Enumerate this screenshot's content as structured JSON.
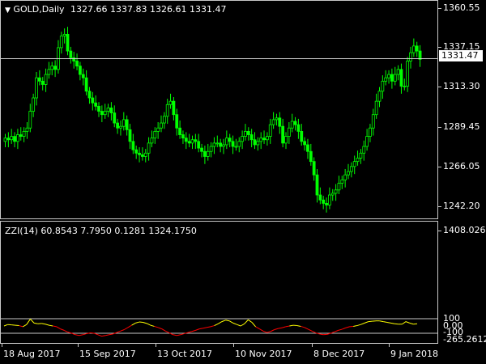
{
  "symbol_header": {
    "icon": "triangle-down-icon",
    "symbol": "GOLD,Daily",
    "ohlc": "1327.66 1337.83 1326.61 1331.47"
  },
  "price_scale": [
    "1360.55",
    "1337.15",
    "1313.30",
    "1289.45",
    "1266.05",
    "1242.20"
  ],
  "current_price": "1331.47",
  "indicator_header": "ZZI(14) 60.8543 7.7950 0.1281 1324.1750",
  "indicator_scale": {
    "max": "1408.0261",
    "upper": "100",
    "zero": "0.00",
    "lower": "-100",
    "min": "-265.2612"
  },
  "date_axis": [
    "18 Aug 2017",
    "15 Sep 2017",
    "13 Oct 2017",
    "10 Nov 2017",
    "8 Dec 2017",
    "9 Jan 2018"
  ],
  "colors": {
    "background": "#000000",
    "candle": "#00ff00",
    "indicator_high": "#ffff00",
    "indicator_low": "#ff0000",
    "grid": "#c8c8c8"
  },
  "chart_data": [
    {
      "type": "candlestick",
      "title": "GOLD,Daily",
      "ylim": [
        1236,
        1366
      ],
      "series": [
        {
          "values": [
            1284,
            1283,
            1285,
            1282,
            1286,
            1285,
            1288,
            1290,
            1300,
            1308,
            1320,
            1318,
            1316,
            1322,
            1325,
            1327,
            1325,
            1338,
            1345,
            1346,
            1336,
            1332,
            1330,
            1327,
            1322,
            1320,
            1312,
            1308,
            1305,
            1303,
            1300,
            1298,
            1300,
            1302,
            1299,
            1293,
            1290,
            1291,
            1295,
            1289,
            1282,
            1277,
            1275,
            1274,
            1273,
            1275,
            1281,
            1284,
            1288,
            1290,
            1293,
            1297,
            1304,
            1306,
            1298,
            1290,
            1286,
            1284,
            1282,
            1281,
            1283,
            1282,
            1278,
            1276,
            1273,
            1276,
            1279,
            1281,
            1281,
            1279,
            1280,
            1284,
            1282,
            1279,
            1279,
            1282,
            1285,
            1288,
            1286,
            1283,
            1280,
            1282,
            1284,
            1283,
            1285,
            1292,
            1295,
            1296,
            1291,
            1281,
            1285,
            1290,
            1294,
            1292,
            1288,
            1282,
            1280,
            1276,
            1270,
            1262,
            1250,
            1247,
            1245,
            1244,
            1250,
            1251,
            1253,
            1257,
            1259,
            1262,
            1264,
            1267,
            1270,
            1272,
            1275,
            1279,
            1285,
            1290,
            1298,
            1306,
            1312,
            1318,
            1320,
            1322,
            1318,
            1322,
            1325,
            1315,
            1315,
            1330,
            1335,
            1339,
            1336,
            1331
          ]
        }
      ]
    },
    {
      "type": "line",
      "title": "ZZI(14)",
      "ylim": [
        -265.2612,
        1408.0261
      ],
      "series": [
        {
          "values": [
            0,
            20,
            15,
            10,
            5,
            -10,
            20,
            95,
            40,
            30,
            35,
            25,
            10,
            0,
            -10,
            -40,
            -60,
            -85,
            -100,
            -120,
            -130,
            -120,
            -105,
            -95,
            -100,
            -120,
            -140,
            -130,
            -120,
            -110,
            -90,
            -70,
            -50,
            -20,
            10,
            40,
            55,
            50,
            35,
            10,
            -5,
            -20,
            -40,
            -70,
            -95,
            -120,
            -130,
            -120,
            -105,
            -90,
            -75,
            -60,
            -40,
            -30,
            -20,
            -10,
            5,
            30,
            60,
            80,
            70,
            40,
            20,
            0,
            30,
            85,
            50,
            -10,
            -40,
            -70,
            -90,
            -75,
            -50,
            -35,
            -25,
            -10,
            0,
            10,
            5,
            -5,
            -20,
            -45,
            -70,
            -95,
            -110,
            -120,
            -115,
            -100,
            -80,
            -60,
            -45,
            -25,
            -10,
            -5,
            5,
            20,
            40,
            60,
            65,
            70,
            70,
            60,
            50,
            40,
            30,
            25,
            25,
            60,
            40,
            25,
            30
          ]
        }
      ]
    }
  ]
}
